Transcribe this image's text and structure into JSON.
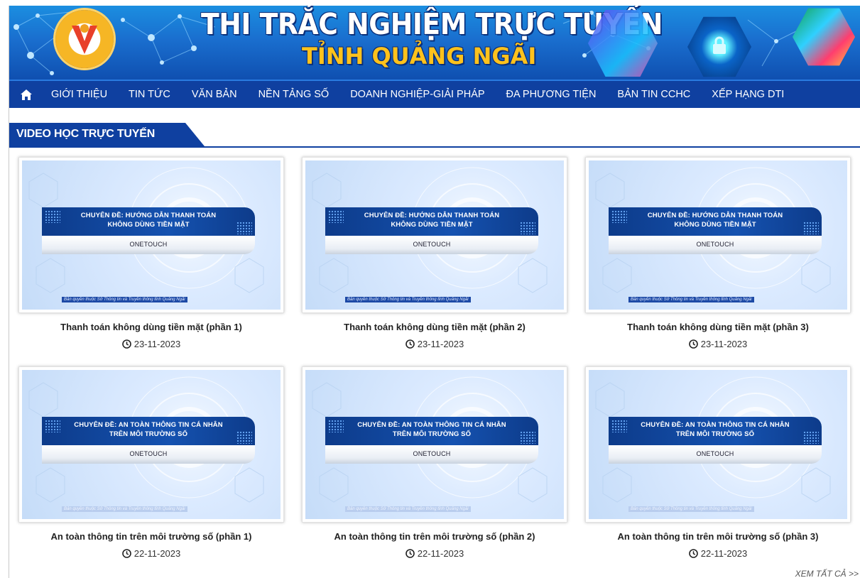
{
  "banner": {
    "title": "THI TRẮC NGHIỆM TRỰC TUYẾN",
    "subtitle": "TỈNH QUẢNG NGÃI"
  },
  "nav": {
    "home_icon": "home-icon",
    "items": [
      "GIỚI THIỆU",
      "TIN TỨC",
      "VĂN BẢN",
      "NỀN TẢNG SỐ",
      "DOANH NGHIỆP-GIẢI PHÁP",
      "ĐA PHƯƠNG TIỆN",
      "BẢN TIN CCHC",
      "XẾP HẠNG DTI"
    ]
  },
  "section": {
    "title": "VIDEO HỌC TRỰC TUYẾN",
    "see_all": "XEM TẤT CẢ >>"
  },
  "videos": [
    {
      "thumb_line1": "CHUYÊN ĐỀ: HƯỚNG DẪN THANH TOÁN",
      "thumb_line2": "KHÔNG DÙNG TIỀN MẶT",
      "brand": "ONETOUCH",
      "copyright": "Bản quyền thuộc Sở Thông tin và Truyền thông tỉnh Quảng Ngãi",
      "title": "Thanh toán không dùng tiền mặt (phần 1)",
      "date": "23-11-2023"
    },
    {
      "thumb_line1": "CHUYÊN ĐỀ: HƯỚNG DẪN THANH TOÁN",
      "thumb_line2": "KHÔNG DÙNG TIỀN MẶT",
      "brand": "ONETOUCH",
      "copyright": "Bản quyền thuộc Sở Thông tin và Truyền thông tỉnh Quảng Ngãi",
      "title": "Thanh toán không dùng tiền mặt (phần 2)",
      "date": "23-11-2023"
    },
    {
      "thumb_line1": "CHUYÊN ĐỀ: HƯỚNG DẪN THANH TOÁN",
      "thumb_line2": "KHÔNG DÙNG TIỀN MẶT",
      "brand": "ONETOUCH",
      "copyright": "Bản quyền thuộc Sở Thông tin và Truyền thông tỉnh Quảng Ngãi",
      "title": "Thanh toán không dùng tiền mặt (phần 3)",
      "date": "23-11-2023"
    },
    {
      "thumb_line1": "CHUYÊN ĐỀ: AN TOÀN THÔNG TIN CÁ NHÂN",
      "thumb_line2": "TRÊN MÔI TRƯỜNG SỐ",
      "brand": "ONETOUCH",
      "copyright": "Bản quyền thuộc Sở Thông tin và Truyền thông tỉnh Quảng Ngãi",
      "title": "An toàn thông tin trên môi trường số (phần 1)",
      "date": "22-11-2023"
    },
    {
      "thumb_line1": "CHUYÊN ĐỀ: AN TOÀN THÔNG TIN CÁ NHÂN",
      "thumb_line2": "TRÊN MÔI TRƯỜNG SỐ",
      "brand": "ONETOUCH",
      "copyright": "Bản quyền thuộc Sở Thông tin và Truyền thông tỉnh Quảng Ngãi",
      "title": "An toàn thông tin trên môi trường số (phần 2)",
      "date": "22-11-2023"
    },
    {
      "thumb_line1": "CHUYÊN ĐỀ: AN TOÀN THÔNG TIN CÁ NHÂN",
      "thumb_line2": "TRÊN MÔI TRƯỜNG SỐ",
      "brand": "ONETOUCH",
      "copyright": "Bản quyền thuộc Sở Thông tin và Truyền thông tỉnh Quảng Ngãi",
      "title": "An toàn thông tin trên môi trường số (phần 3)",
      "date": "22-11-2023"
    }
  ],
  "colors": {
    "nav_bg": "#0f40a0",
    "banner_subtitle": "#ffc21c",
    "ribbon_blue": "#0d3b8a"
  }
}
